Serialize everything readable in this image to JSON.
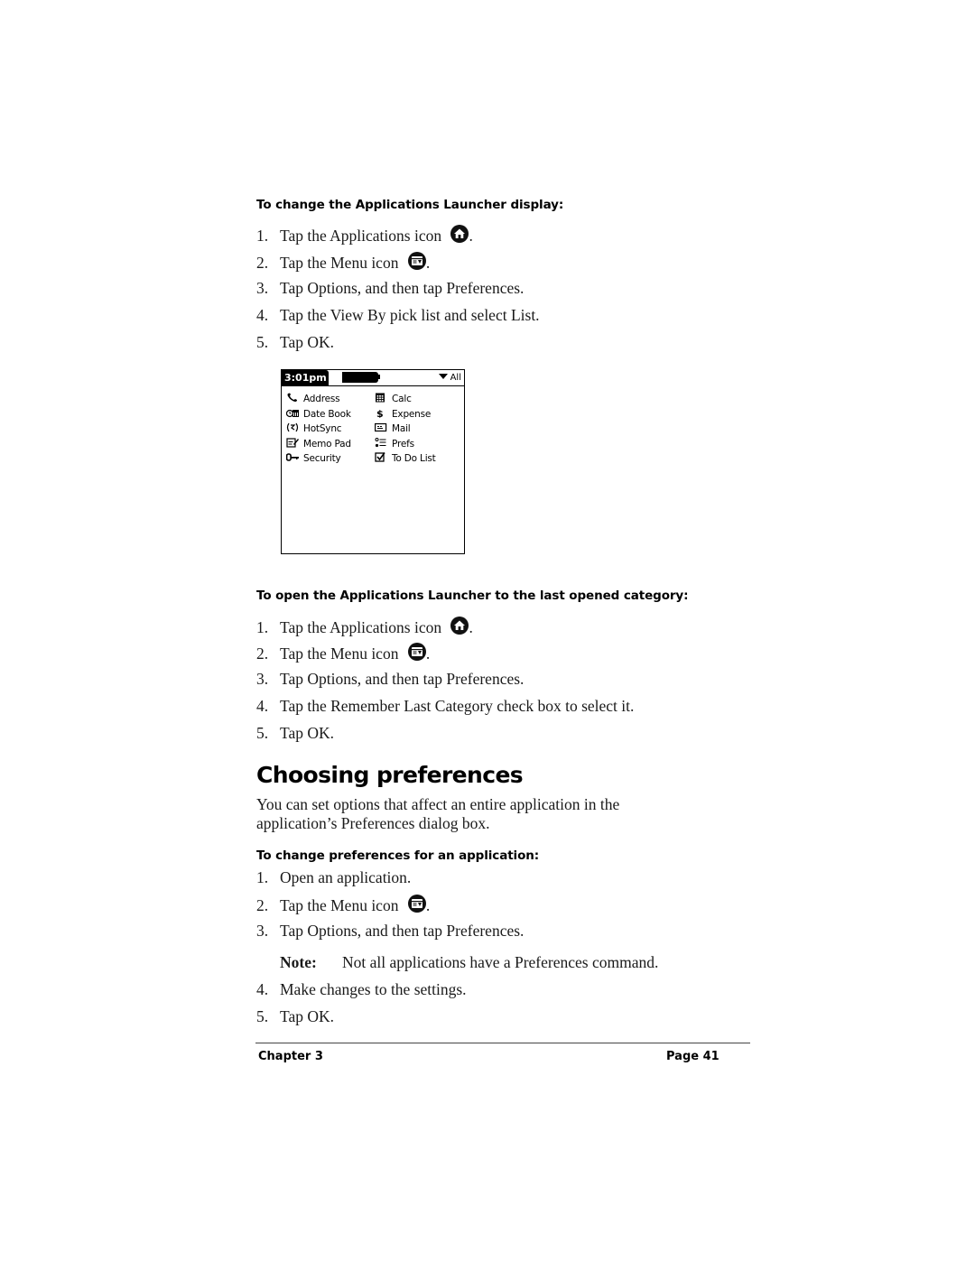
{
  "sections": [
    {
      "heading": "To change the Applications Launcher display:",
      "steps": [
        {
          "num": "1.",
          "text": "Tap the Applications icon",
          "icon": "applications-icon",
          "suffix": "."
        },
        {
          "num": "2.",
          "text": "Tap the Menu icon",
          "icon": "menu-icon",
          "suffix": "."
        },
        {
          "num": "3.",
          "text": "Tap Options, and then tap Preferences."
        },
        {
          "num": "4.",
          "text": "Tap the View By pick list and select List."
        },
        {
          "num": "5.",
          "text": "Tap OK."
        }
      ]
    },
    {
      "heading": "To open the Applications Launcher to the last opened category:",
      "steps": [
        {
          "num": "1.",
          "text": "Tap the Applications icon",
          "icon": "applications-icon",
          "suffix": "."
        },
        {
          "num": "2.",
          "text": "Tap the Menu icon",
          "icon": "menu-icon",
          "suffix": "."
        },
        {
          "num": "3.",
          "text": "Tap Options, and then tap Preferences."
        },
        {
          "num": "4.",
          "text": "Tap the Remember Last Category check box to select it."
        },
        {
          "num": "5.",
          "text": "Tap OK."
        }
      ]
    },
    {
      "title": "Choosing preferences",
      "intro": "You can set options that affect an entire application in the application’s Preferences dialog box.",
      "heading": "To change preferences for an application:",
      "steps": [
        {
          "num": "1.",
          "text": "Open an application."
        },
        {
          "num": "2.",
          "text": "Tap the Menu icon",
          "icon": "menu-icon",
          "suffix": "."
        },
        {
          "num": "3.",
          "text": "Tap Options, and then tap Preferences."
        },
        {
          "num": "4.",
          "text": "Make changes to the settings."
        },
        {
          "num": "5.",
          "text": "Tap OK."
        }
      ],
      "note": {
        "label": "Note:",
        "text": "Not all applications have a Preferences command."
      }
    }
  ],
  "palm_screen": {
    "time": "3:01pm",
    "category": "All",
    "category_icon": "dropdown-triangle-icon",
    "apps": [
      {
        "label": "Address",
        "icon": "phone-handset-icon"
      },
      {
        "label": "Calc",
        "icon": "calculator-icon"
      },
      {
        "label": "Date Book",
        "icon": "clock-calendar-icon"
      },
      {
        "label": "Expense",
        "icon": "dollar-icon"
      },
      {
        "label": "HotSync",
        "icon": "hotsync-icon"
      },
      {
        "label": "Mail",
        "icon": "mail-icon"
      },
      {
        "label": "Memo Pad",
        "icon": "memo-pad-icon"
      },
      {
        "label": "Prefs",
        "icon": "prefs-icon"
      },
      {
        "label": "Security",
        "icon": "key-icon"
      },
      {
        "label": "To Do List",
        "icon": "checkbox-icon"
      }
    ]
  },
  "footer": {
    "chapter": "Chapter 3",
    "page": "Page 41"
  }
}
